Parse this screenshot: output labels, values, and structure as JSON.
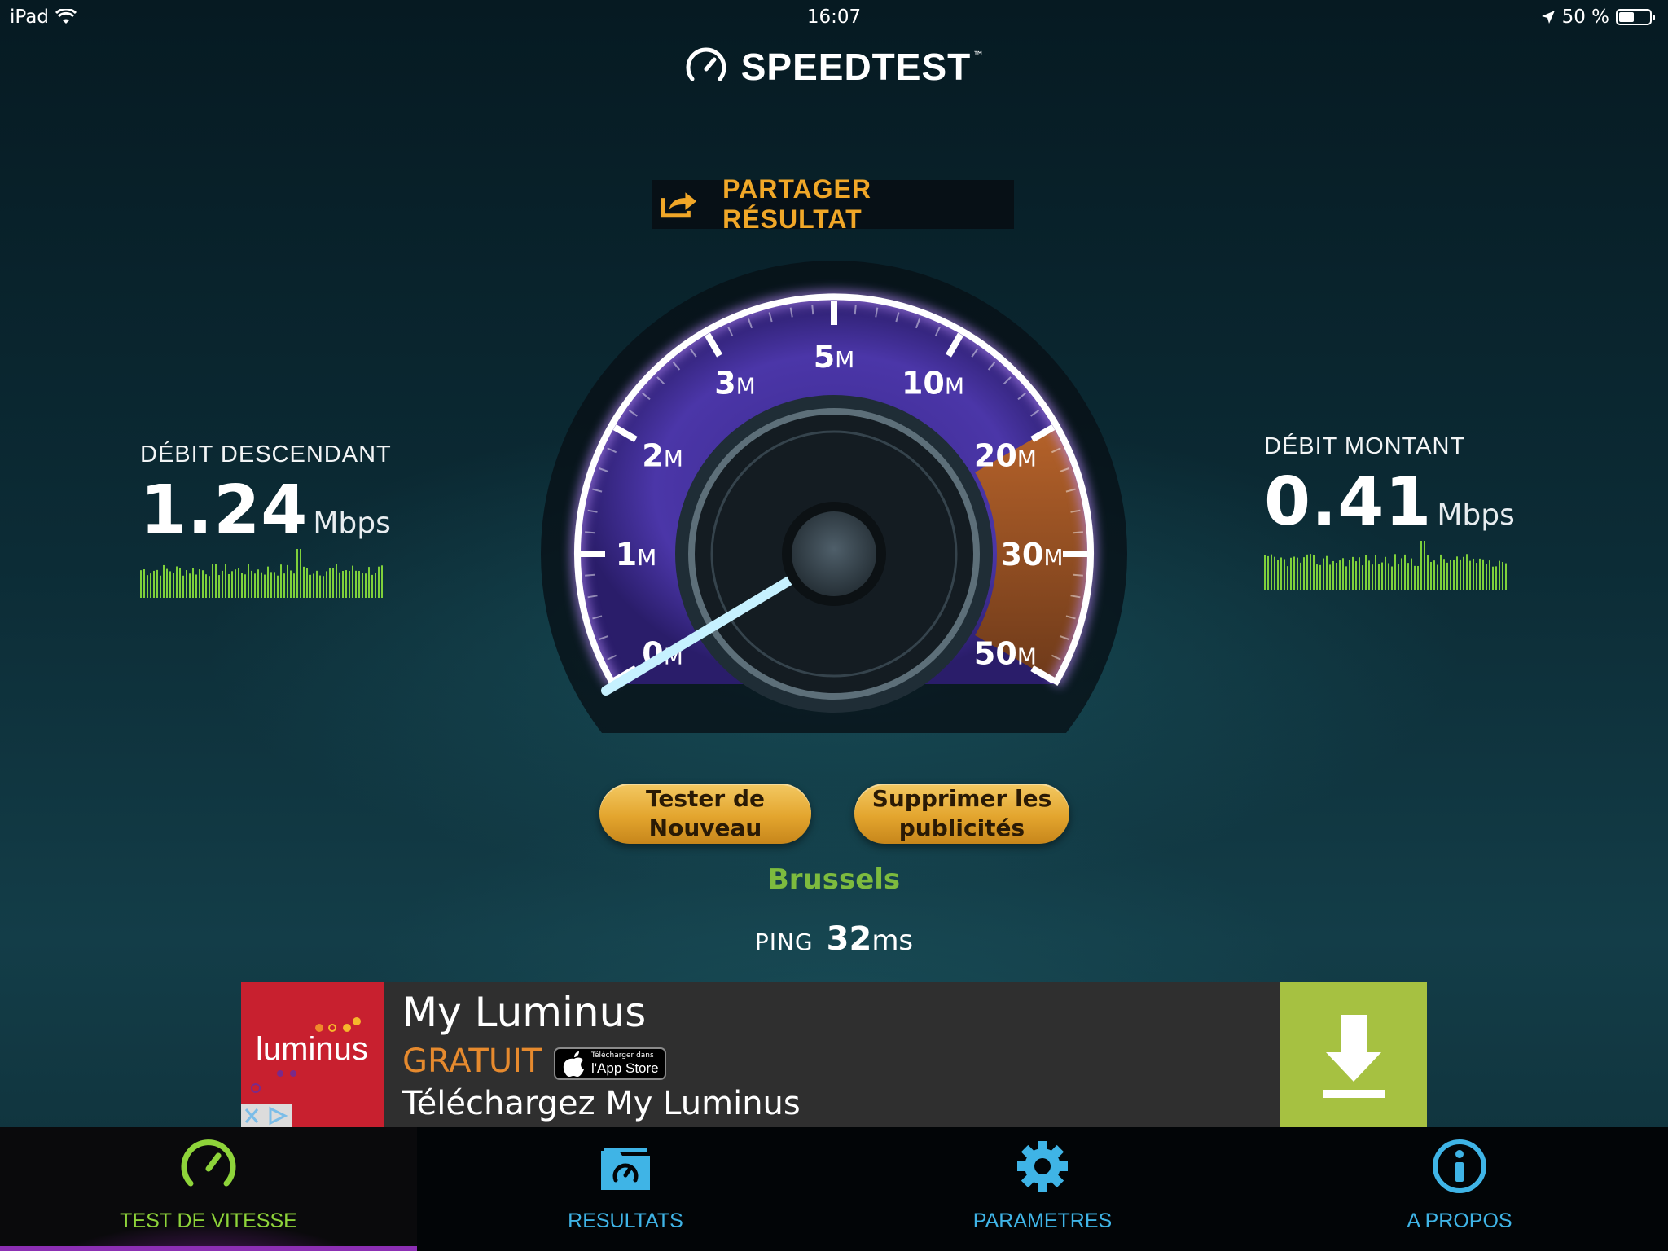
{
  "status": {
    "device": "iPad",
    "time": "16:07",
    "battery": "50 %"
  },
  "app": {
    "title": "SPEEDTEST",
    "tm": "™"
  },
  "share": {
    "label": "PARTAGER  RÉSULTAT"
  },
  "download": {
    "label": "DÉBIT DESCENDANT",
    "value": "1.24",
    "unit": "Mbps"
  },
  "upload": {
    "label": "DÉBIT MONTANT",
    "value": "0.41",
    "unit": "Mbps"
  },
  "gauge": {
    "ticks": [
      {
        "n": "0",
        "u": "M"
      },
      {
        "n": "1",
        "u": "M"
      },
      {
        "n": "2",
        "u": "M"
      },
      {
        "n": "3",
        "u": "M"
      },
      {
        "n": "5",
        "u": "M"
      },
      {
        "n": "10",
        "u": "M"
      },
      {
        "n": "20",
        "u": "M"
      },
      {
        "n": "30",
        "u": "M"
      },
      {
        "n": "50",
        "u": "M"
      }
    ],
    "needle_value_mbps": 0.41
  },
  "buttons": {
    "retest": "Tester de Nouveau",
    "remove_ads": "Supprimer les publicités"
  },
  "server": {
    "city": "Brussels"
  },
  "ping": {
    "label": "PING",
    "value": "32",
    "unit": "ms"
  },
  "ad": {
    "brand": "luminus",
    "title": "My Luminus",
    "price": "GRATUIT",
    "store_small": "Télécharger dans",
    "store_big": "l'App Store",
    "subtitle": "Téléchargez My Luminus"
  },
  "tabs": [
    {
      "label": "TEST DE VITESSE",
      "icon": "speedometer-icon",
      "active": true
    },
    {
      "label": "RESULTATS",
      "icon": "results-folder-icon",
      "active": false
    },
    {
      "label": "PARAMETRES",
      "icon": "gear-icon",
      "active": false
    },
    {
      "label": "A PROPOS",
      "icon": "info-icon",
      "active": false
    }
  ],
  "colors": {
    "accent_orange": "#f0a728",
    "city_green": "#7dbb3e",
    "tab_active": "#8ed43a",
    "tab_inactive": "#3fb4e6"
  }
}
